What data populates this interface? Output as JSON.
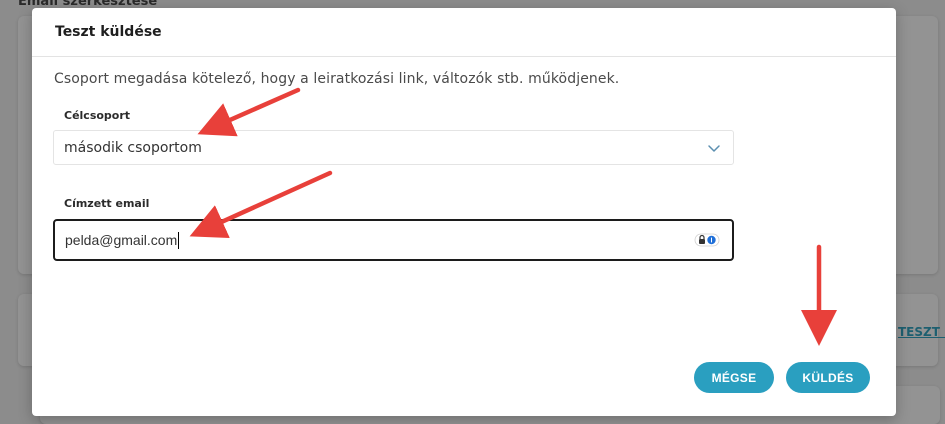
{
  "background": {
    "title": "Email szerkesztése",
    "link": "TESZT KÜ"
  },
  "modal": {
    "title": "Teszt küldése",
    "description": "Csoport megadása kötelező, hogy a leiratkozási link, változók stb. működjenek.",
    "group_label": "Célcsoport",
    "group_value": "második csoportom",
    "email_label": "Címzett email",
    "email_value": "pelda@gmail.com",
    "cancel_label": "MÉGSE",
    "send_label": "KÜLDÉS"
  },
  "colors": {
    "button": "#2a9fc0",
    "arrow": "#e8403a"
  },
  "icons": {
    "select": "chevron-down-icon",
    "password": "password-manager-icon"
  }
}
